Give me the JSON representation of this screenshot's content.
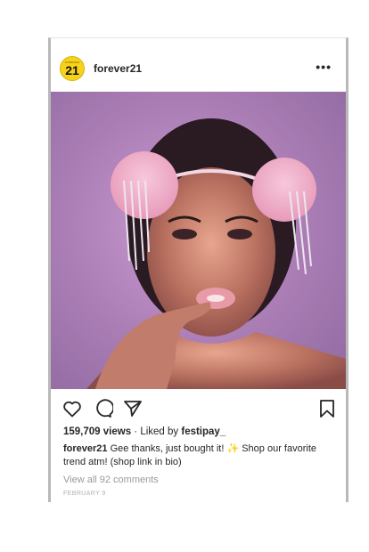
{
  "post": {
    "avatar": {
      "top_text": "FOREVER",
      "number": "21",
      "bg": "#f6d21a"
    },
    "username": "forever21",
    "more": "•••",
    "image_alt": "model with pink fluffy pom-pom hair clips and crystal fringe",
    "icons": [
      "heart-icon",
      "comment-icon",
      "share-icon",
      "bookmark-icon"
    ],
    "views_count": "159,709 views",
    "liked_by_prefix": "· Liked by",
    "liked_by_user": "festipay_",
    "caption_user": "forever21",
    "caption_text": "Gee thanks, just bought it! ✨ Shop our favorite trend atm! (shop link in bio)",
    "view_comments": "View all 92 comments",
    "date": "FEBRUARY 9"
  }
}
